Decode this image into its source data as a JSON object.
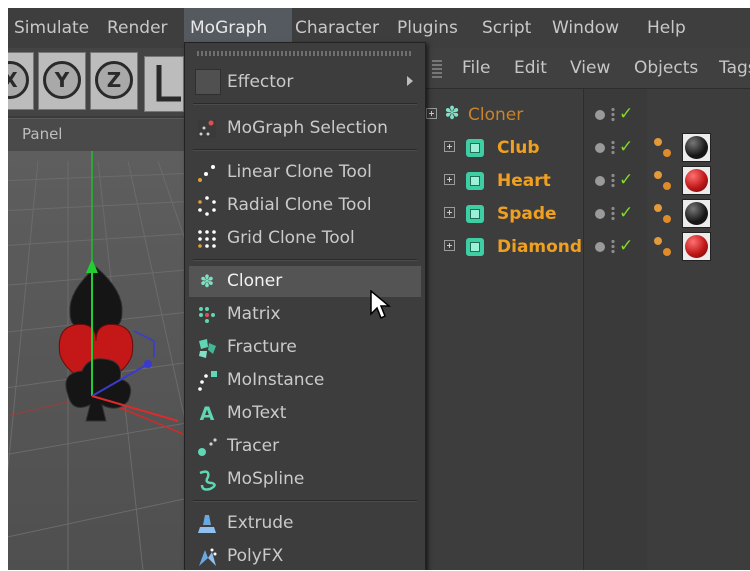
{
  "menubar": {
    "items": [
      {
        "label": "Simulate"
      },
      {
        "label": "Render"
      },
      {
        "label": "MoGraph"
      },
      {
        "label": "Character"
      },
      {
        "label": "Plugins"
      },
      {
        "label": "Script"
      },
      {
        "label": "Window"
      },
      {
        "label": "Help"
      }
    ],
    "active": "MoGraph"
  },
  "toolbar": {
    "axis_x": "X",
    "axis_y": "Y",
    "axis_z": "Z"
  },
  "panel": {
    "label": "Panel"
  },
  "object_manager": {
    "menu": [
      "File",
      "Edit",
      "View",
      "Objects",
      "Tags"
    ],
    "objects": [
      {
        "name": "Cloner",
        "type": "cloner",
        "color": "#d08a2c",
        "material": null
      },
      {
        "name": "Club",
        "type": "null",
        "color": "#f0a020",
        "material": "#151515"
      },
      {
        "name": "Heart",
        "type": "null",
        "color": "#f0a020",
        "material": "#c01818"
      },
      {
        "name": "Spade",
        "type": "null",
        "color": "#f0a020",
        "material": "#151515"
      },
      {
        "name": "Diamond",
        "type": "null",
        "color": "#f0a020",
        "material": "#c01818"
      }
    ]
  },
  "dropdown": {
    "items": [
      {
        "label": "Effector",
        "icon": "effector-box-icon",
        "submenu": true
      },
      {
        "label": "MoGraph Selection",
        "icon": "mograph-selection-icon"
      },
      {
        "label": "Linear Clone Tool",
        "icon": "linear-clone-icon"
      },
      {
        "label": "Radial Clone Tool",
        "icon": "radial-clone-icon"
      },
      {
        "label": "Grid Clone Tool",
        "icon": "grid-clone-icon"
      },
      {
        "label": "Cloner",
        "icon": "cloner-icon",
        "highlighted": true
      },
      {
        "label": "Matrix",
        "icon": "matrix-icon"
      },
      {
        "label": "Fracture",
        "icon": "fracture-icon"
      },
      {
        "label": "MoInstance",
        "icon": "moinstance-icon"
      },
      {
        "label": "MoText",
        "icon": "motext-icon"
      },
      {
        "label": "Tracer",
        "icon": "tracer-icon"
      },
      {
        "label": "MoSpline",
        "icon": "mospline-icon"
      },
      {
        "label": "Extrude",
        "icon": "extrude-icon"
      },
      {
        "label": "PolyFX",
        "icon": "polyfx-icon"
      }
    ]
  },
  "colors": {
    "accent": "#f0a020",
    "check": "#7fdc2a",
    "highlight": "#545454"
  }
}
